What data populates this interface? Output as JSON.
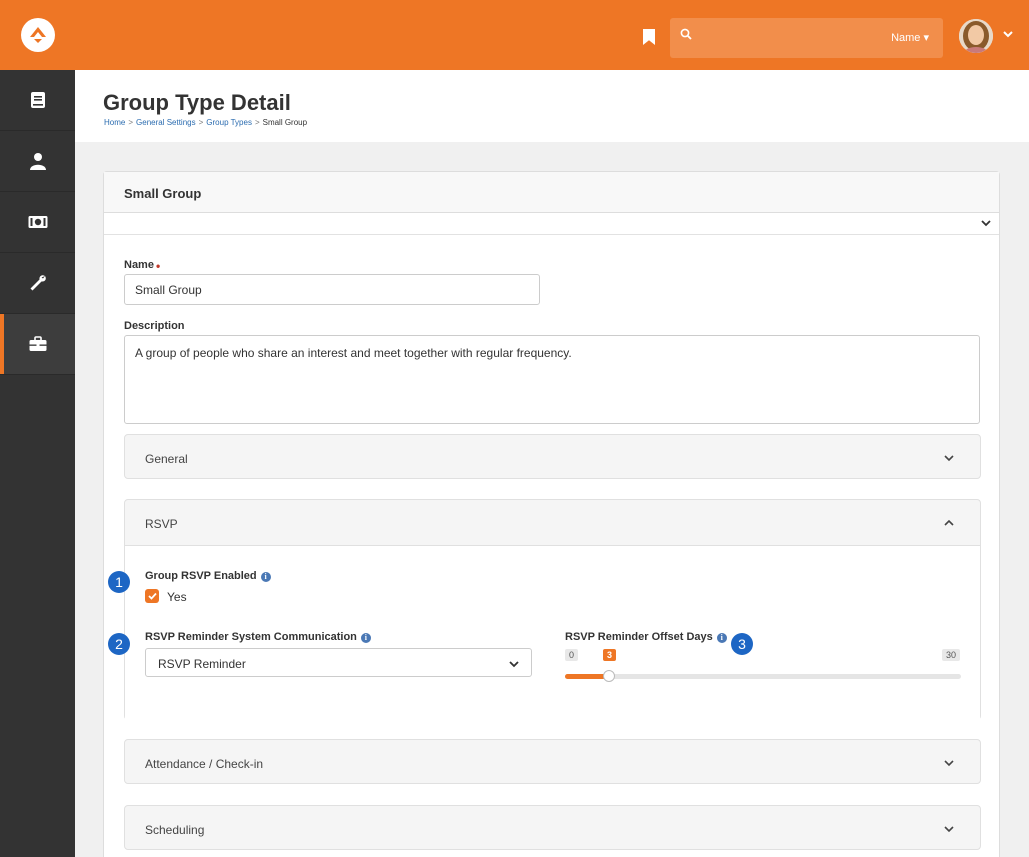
{
  "colors": {
    "brand": "#ee7625",
    "sidebar": "#333333",
    "link": "#2b6cb0",
    "callout": "#1d66c4"
  },
  "topbar": {
    "search_placeholder": "",
    "search_filter": "Name"
  },
  "sidebar": {
    "items": [
      {
        "icon": "book-icon"
      },
      {
        "icon": "person-icon"
      },
      {
        "icon": "money-icon"
      },
      {
        "icon": "wrench-icon"
      },
      {
        "icon": "briefcase-icon",
        "active": true
      }
    ]
  },
  "header": {
    "title": "Group Type Detail",
    "breadcrumb": [
      "Home",
      "General Settings",
      "Group Types",
      "Small Group"
    ]
  },
  "panel": {
    "heading": "Small Group",
    "name_label": "Name",
    "name_value": "Small Group",
    "description_label": "Description",
    "description_value": "A group of people who share an interest and meet together with regular frequency."
  },
  "sections": {
    "general": "General",
    "rsvp": "RSVP",
    "attendance": "Attendance / Check-in",
    "scheduling": "Scheduling"
  },
  "rsvp": {
    "enabled_label": "Group RSVP Enabled",
    "enabled_option": "Yes",
    "enabled_checked": true,
    "reminder_comm_label": "RSVP Reminder System Communication",
    "reminder_comm_value": "RSVP Reminder",
    "offset_label": "RSVP Reminder Offset Days",
    "offset_min": "0",
    "offset_max": "30",
    "offset_value": "3"
  },
  "callouts": [
    "1",
    "2",
    "3"
  ]
}
